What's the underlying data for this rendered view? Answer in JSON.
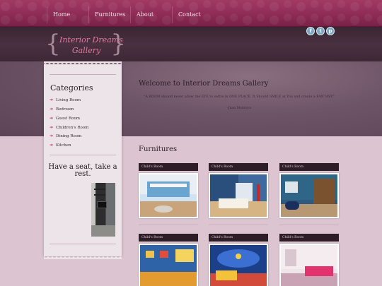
{
  "nav": {
    "items": [
      {
        "label": "Home"
      },
      {
        "label": "Furnitures"
      },
      {
        "label": "About"
      },
      {
        "label": "Contact"
      }
    ]
  },
  "logo": {
    "line1": "Interior Dreams",
    "line2": "Gallery"
  },
  "social": {
    "facebook": "f",
    "twitter": "t",
    "pinterest": "p"
  },
  "welcome": {
    "title": "Welcome to Interior Dreams Gallery",
    "quote": "\"A ROOM should never allow the EYE to settle in ONE PLACE. It Should SMILE at You and create a FANTASY\"",
    "author": "-Juan Montoya"
  },
  "sidebar": {
    "categories_title": "Categories",
    "categories": [
      "Living Room",
      "Bedroom",
      "Guest Room",
      "Children's Room",
      "Dining Room",
      "Kitchen"
    ],
    "rest_title": "Have a seat, take a rest."
  },
  "furnitures": {
    "title": "Furnitures",
    "cards": [
      {
        "label": "Child's Room"
      },
      {
        "label": "Child's Room"
      },
      {
        "label": "Child's Room"
      },
      {
        "label": "Child's Room"
      },
      {
        "label": "Child's Room"
      },
      {
        "label": "Child's Room"
      }
    ]
  },
  "colors": {
    "accent": "#c2185b",
    "nav": "#8c2b54",
    "card_header": "#2d1d27"
  }
}
